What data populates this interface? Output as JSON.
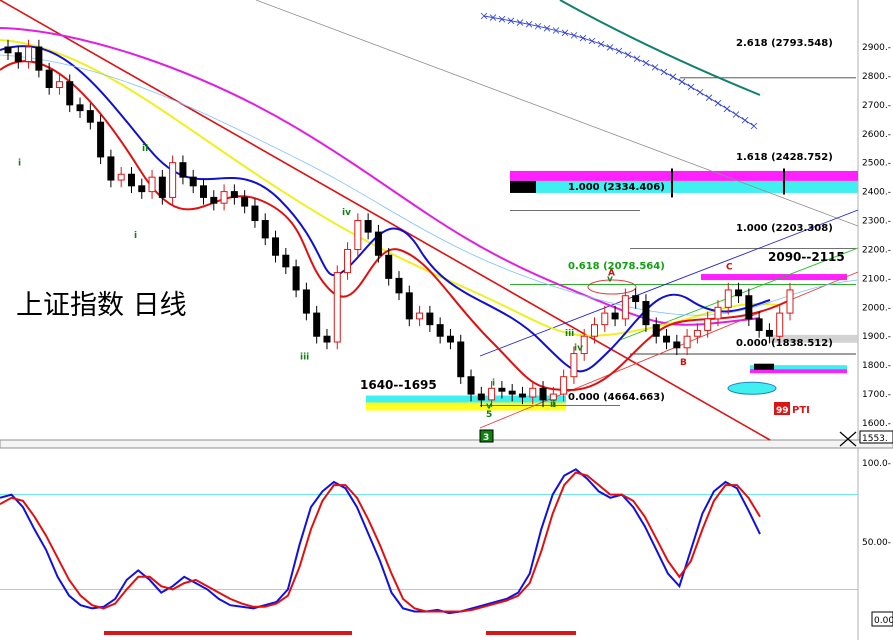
{
  "title": "上证指数  日线",
  "colors": {
    "up": "#d81818",
    "down": "#000000",
    "ma_red": "#e01010",
    "ma_blue": "#1010d0",
    "ma_yellow": "#f0f020",
    "ma_magenta": "#e020e0",
    "band_cyan": "#40f0f0",
    "band_yellow": "#ffff20",
    "band_magenta": "#ff20ff",
    "osc_fast": "#1010e0",
    "osc_slow": "#e01010"
  },
  "fib_labels": [
    {
      "text": "2.618 (2793.548)",
      "value": 2793.5
    },
    {
      "text": "1.618 (2428.752)",
      "value": 2428.8
    },
    {
      "text": "1.000 (2334.406)",
      "value": 2334.4
    },
    {
      "text": "1.000 (2203.308)",
      "value": 2203.3
    },
    {
      "text": "0.618 (2078.564)",
      "value": 2078.6
    },
    {
      "text": "0.000 (1838.512)",
      "value": 1838.5
    },
    {
      "text": "0.000 (4664.663)",
      "value": 1660
    }
  ],
  "zone_labels": {
    "low_zone": "1640--1695",
    "high_zone": "2090--2115"
  },
  "badges": {
    "pti": "99",
    "pti_text": "PTI",
    "wave_box": "3",
    "current_price": "1553.",
    "osc_value": "0.00"
  },
  "chart_data": [
    {
      "type": "candlestick",
      "title": "上证指数  日线",
      "ylim": [
        1560,
        2960
      ],
      "yticks": [
        {
          "value": 2900,
          "label": "2900.-"
        },
        {
          "value": 2800,
          "label": "2800.-"
        },
        {
          "value": 2700,
          "label": "2700.-"
        },
        {
          "value": 2600,
          "label": "2600.-"
        },
        {
          "value": 2500,
          "label": "2500.-"
        },
        {
          "value": 2400,
          "label": "2400.-"
        },
        {
          "value": 2300,
          "label": "2300.-"
        },
        {
          "value": 2200,
          "label": "2200.-"
        },
        {
          "value": 2100,
          "label": "2100.-"
        },
        {
          "value": 2000,
          "label": "2000.-"
        },
        {
          "value": 1900,
          "label": "1900.-"
        },
        {
          "value": 1800,
          "label": "1800.-"
        },
        {
          "value": 1700,
          "label": "1700.-"
        },
        {
          "value": 1600,
          "label": "1600.-"
        }
      ],
      "wave_labels": [
        {
          "text": "i",
          "value": 2490
        },
        {
          "text": "ii",
          "value": 2540
        },
        {
          "text": "i",
          "value": 2240
        },
        {
          "text": "iii",
          "value": 1820
        },
        {
          "text": "iv",
          "value": 2320
        },
        {
          "text": "v",
          "value": 1650
        },
        {
          "text": "5",
          "value": 1620
        },
        {
          "text": "i",
          "value": 1730
        },
        {
          "text": "ii",
          "value": 1655
        },
        {
          "text": "iii",
          "value": 1900
        },
        {
          "text": "iv",
          "value": 1850
        },
        {
          "text": "v",
          "value": 2090
        },
        {
          "text": "A",
          "value": 2110
        },
        {
          "text": "B",
          "value": 1800
        },
        {
          "text": "C",
          "value": 2130
        }
      ]
    },
    {
      "type": "line",
      "ylim": [
        0,
        100
      ],
      "yticks": [
        {
          "value": 100,
          "label": "100.0-"
        },
        {
          "value": 50,
          "label": "50.00-"
        }
      ],
      "levels": [
        80,
        20
      ],
      "series": [
        {
          "values": [
            78,
            80,
            72,
            58,
            45,
            28,
            16,
            10,
            8,
            9,
            14,
            26,
            32,
            26,
            18,
            22,
            28,
            24,
            20,
            14,
            10,
            9,
            8,
            10,
            12,
            20,
            48,
            72,
            82,
            88,
            84,
            72,
            55,
            38,
            18,
            8,
            6,
            6,
            7,
            5,
            6,
            8,
            10,
            12,
            14,
            18,
            30,
            58,
            80,
            92,
            96,
            90,
            82,
            78,
            80,
            72,
            60,
            45,
            30,
            22,
            45,
            68,
            82,
            88,
            84,
            70,
            55
          ]
        },
        {
          "values": [
            74,
            78,
            76,
            66,
            54,
            40,
            26,
            16,
            10,
            8,
            11,
            20,
            28,
            28,
            22,
            20,
            24,
            26,
            22,
            18,
            14,
            11,
            9,
            9,
            11,
            16,
            34,
            58,
            76,
            86,
            86,
            78,
            64,
            48,
            30,
            14,
            8,
            6,
            6,
            6,
            6,
            7,
            9,
            11,
            13,
            16,
            24,
            44,
            68,
            86,
            94,
            92,
            86,
            80,
            80,
            76,
            66,
            52,
            38,
            28,
            38,
            58,
            76,
            86,
            86,
            78,
            66
          ]
        }
      ]
    }
  ]
}
